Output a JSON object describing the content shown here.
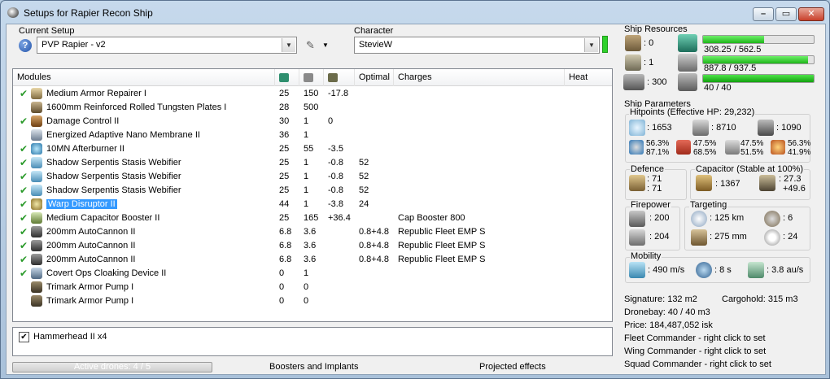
{
  "window": {
    "title": "Setups for Rapier Recon Ship"
  },
  "setup": {
    "label": "Current Setup",
    "value": "PVP Rapier - v2"
  },
  "character": {
    "label": "Character",
    "value": "StevieW"
  },
  "modules": {
    "columns": [
      "Modules",
      "",
      "",
      "",
      "Optimal",
      "Charges",
      "Heat"
    ],
    "column_icons": [
      "cpu-icon",
      "powergrid-icon",
      "capacitor-icon"
    ],
    "rows": [
      {
        "fit": true,
        "icon": "armor-repairer-icon",
        "name": "Medium Armor Repairer I",
        "cpu": "25",
        "pg": "150",
        "cap": "-17.8",
        "optimal": "",
        "charges": ""
      },
      {
        "fit": false,
        "icon": "armor-plate-icon",
        "name": "1600mm Reinforced Rolled Tungsten Plates I",
        "cpu": "28",
        "pg": "500",
        "cap": "",
        "optimal": "",
        "charges": ""
      },
      {
        "fit": true,
        "icon": "damage-control-icon",
        "name": "Damage Control II",
        "cpu": "30",
        "pg": "1",
        "cap": "0",
        "optimal": "",
        "charges": ""
      },
      {
        "fit": false,
        "icon": "membrane-icon",
        "name": "Energized Adaptive Nano Membrane II",
        "cpu": "36",
        "pg": "1",
        "cap": "",
        "optimal": "",
        "charges": ""
      },
      {
        "fit": true,
        "icon": "afterburner-icon",
        "name": "10MN Afterburner II",
        "cpu": "25",
        "pg": "55",
        "cap": "-3.5",
        "optimal": "",
        "charges": ""
      },
      {
        "fit": true,
        "icon": "webifier-icon",
        "name": "Shadow Serpentis Stasis Webifier",
        "cpu": "25",
        "pg": "1",
        "cap": "-0.8",
        "optimal": "52",
        "charges": ""
      },
      {
        "fit": true,
        "icon": "webifier-icon",
        "name": "Shadow Serpentis Stasis Webifier",
        "cpu": "25",
        "pg": "1",
        "cap": "-0.8",
        "optimal": "52",
        "charges": ""
      },
      {
        "fit": true,
        "icon": "webifier-icon",
        "name": "Shadow Serpentis Stasis Webifier",
        "cpu": "25",
        "pg": "1",
        "cap": "-0.8",
        "optimal": "52",
        "charges": ""
      },
      {
        "fit": true,
        "icon": "warp-disruptor-icon",
        "name": "Warp Disruptor II",
        "cpu": "44",
        "pg": "1",
        "cap": "-3.8",
        "optimal": "24",
        "charges": "",
        "selected": true
      },
      {
        "fit": true,
        "icon": "cap-booster-icon",
        "name": "Medium Capacitor Booster II",
        "cpu": "25",
        "pg": "165",
        "cap": "+36.4",
        "optimal": "",
        "charges": "Cap Booster 800"
      },
      {
        "fit": true,
        "icon": "autocannon-icon",
        "name": "200mm AutoCannon II",
        "cpu": "6.8",
        "pg": "3.6",
        "cap": "",
        "optimal": "0.8+4.8",
        "charges": "Republic Fleet EMP S"
      },
      {
        "fit": true,
        "icon": "autocannon-icon",
        "name": "200mm AutoCannon II",
        "cpu": "6.8",
        "pg": "3.6",
        "cap": "",
        "optimal": "0.8+4.8",
        "charges": "Republic Fleet EMP S"
      },
      {
        "fit": true,
        "icon": "autocannon-icon",
        "name": "200mm AutoCannon II",
        "cpu": "6.8",
        "pg": "3.6",
        "cap": "",
        "optimal": "0.8+4.8",
        "charges": "Republic Fleet EMP S"
      },
      {
        "fit": true,
        "icon": "cloak-icon",
        "name": "Covert Ops Cloaking Device II",
        "cpu": "0",
        "pg": "1",
        "cap": "",
        "optimal": "",
        "charges": ""
      },
      {
        "fit": false,
        "icon": "rig-icon",
        "name": "Trimark Armor Pump I",
        "cpu": "0",
        "pg": "0",
        "cap": "",
        "optimal": "",
        "charges": ""
      },
      {
        "fit": false,
        "icon": "rig-icon",
        "name": "Trimark Armor Pump I",
        "cpu": "0",
        "pg": "0",
        "cap": "",
        "optimal": "",
        "charges": ""
      }
    ]
  },
  "drones": {
    "checked": true,
    "label": "Hammerhead II x4"
  },
  "bottom": {
    "active_drones": "Active drones: 4 / 5",
    "tab_boosters": "Boosters and Implants",
    "tab_projected": "Projected effects"
  },
  "resources": {
    "label": "Ship Resources",
    "turret": ": 0",
    "launcher": ": 1",
    "calibration": ": 300",
    "cpu": {
      "text": "308.25 / 562.5",
      "fraction": 0.548
    },
    "pg": {
      "text": "887.8 / 937.5",
      "fraction": 0.947
    },
    "drone": {
      "text": "40 / 40",
      "fraction": 1.0
    }
  },
  "params": {
    "label": "Ship Parameters",
    "hp_label": "Hitpoints (Effective HP: 29,232)",
    "shield_hp": ": 1653",
    "armor_hp": ": 8710",
    "hull_hp": ": 1090",
    "res": [
      {
        "a": "56.3%",
        "b": "87.1%"
      },
      {
        "a": "47.5%",
        "b": "68.5%"
      },
      {
        "a": "47.5%",
        "b": "51.5%"
      },
      {
        "a": "56.3%",
        "b": "41.9%"
      }
    ],
    "defence_label": "Defence",
    "def_a": ": 71",
    "def_b": ": 71",
    "cap_label": "Capacitor (Stable at 100%)",
    "cap_amount": ": 1367",
    "cap_a": ": 27.3",
    "cap_b": "+49.6",
    "firepower_label": "Firepower",
    "fp_turret": ": 200",
    "fp_drone": ": 204",
    "targeting_label": "Targeting",
    "t_range": ": 125 km",
    "t_targets": ": 6",
    "t_res": ": 275 mm",
    "t_sensor": ": 24",
    "mobility_label": "Mobility",
    "speed": ": 490 m/s",
    "align": ": 8 s",
    "warp": ": 3.8 au/s"
  },
  "info": {
    "signature": "Signature: 132 m2",
    "cargohold": "Cargohold: 315 m3",
    "dronebay": "Dronebay: 40 / 40 m3",
    "price": "Price: 184,487,052 isk",
    "fleet": "Fleet Commander - right click to set",
    "wing": "Wing Commander - right click to set",
    "squad": "Squad Commander - right click to set"
  }
}
